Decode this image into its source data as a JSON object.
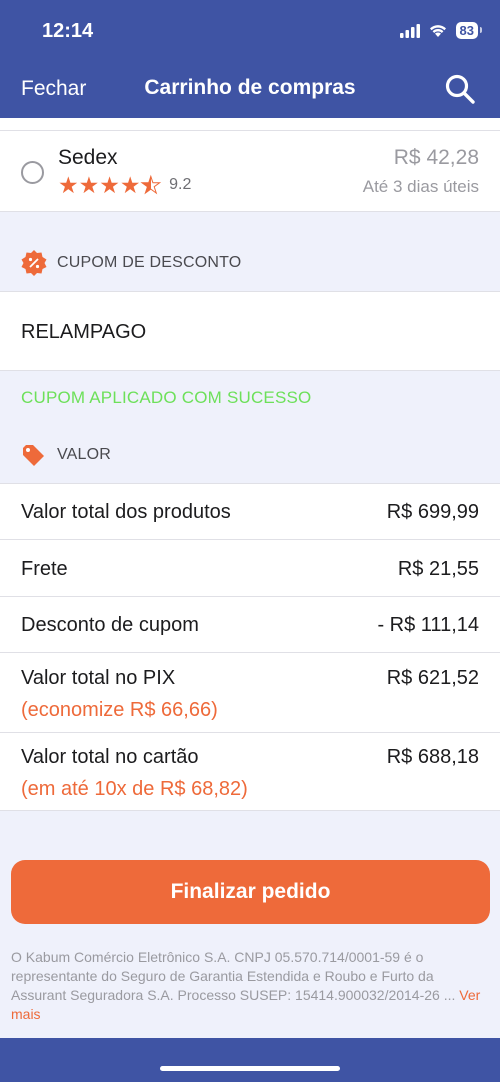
{
  "status": {
    "time": "12:14",
    "battery": "83"
  },
  "nav": {
    "close": "Fechar",
    "title": "Carrinho de compras"
  },
  "shipping": {
    "name": "Sedex",
    "rating": "9.2",
    "stars": 4.5,
    "price": "R$ 42,28",
    "time": "Até 3 dias úteis"
  },
  "coupon": {
    "section": "CUPOM DE DESCONTO",
    "code": "RELAMPAGO",
    "success": "CUPOM APLICADO COM SUCESSO"
  },
  "value": {
    "section": "VALOR",
    "rows": [
      {
        "label": "Valor total dos produtos",
        "value": "R$ 699,99"
      },
      {
        "label": "Frete",
        "value": "R$ 21,55"
      },
      {
        "label": "Desconto de cupom",
        "value": "- R$ 111,14"
      },
      {
        "label": "Valor total no PIX",
        "value": "R$ 621,52",
        "sub": "(economize R$ 66,66)"
      },
      {
        "label": "Valor total no cartão",
        "value": "R$ 688,18",
        "sub": "(em até 10x de R$ 68,82)"
      }
    ]
  },
  "button": {
    "label": "Finalizar pedido"
  },
  "legal": {
    "text": "O Kabum Comércio Eletrônico S.A. CNPJ 05.570.714/0001-59 é o representante do Seguro de Garantia Estendida e Roubo e Furto da Assurant Seguradora S.A. Processo SUSEP: 15414.900032/2014-26 ...",
    "more": "Ver mais"
  },
  "colors": {
    "brand": "#3f54a4",
    "accent": "#ee6a3a",
    "success": "#6de05a"
  }
}
